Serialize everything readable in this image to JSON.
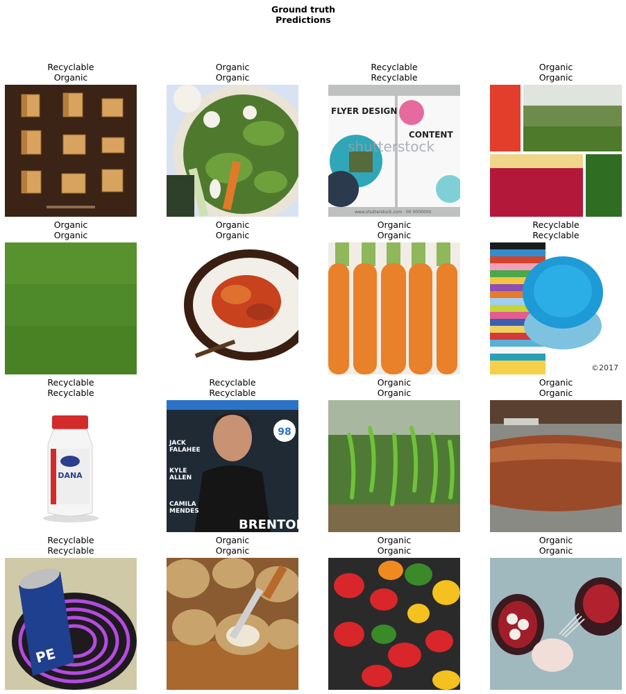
{
  "figure": {
    "title_line1": "Ground truth",
    "title_line2": "Predictions"
  },
  "tiles": [
    {
      "truth": "Recyclable",
      "pred": "Organic",
      "icon": "cardboard-boxes-image"
    },
    {
      "truth": "Organic",
      "pred": "Organic",
      "icon": "vegetable-bowl-image"
    },
    {
      "truth": "Recyclable",
      "pred": "Recyclable",
      "icon": "flyer-design-image",
      "text_a": "FLYER DESIGN",
      "text_b": "CONTENT",
      "text_c": "shutterstock",
      "text_d": "www.shutterstock.com · 00 0000000"
    },
    {
      "truth": "Organic",
      "pred": "Organic",
      "icon": "garden-collage-image"
    },
    {
      "truth": "Organic",
      "pred": "Organic",
      "icon": "grass-image"
    },
    {
      "truth": "Organic",
      "pred": "Organic",
      "icon": "food-plate-image"
    },
    {
      "truth": "Organic",
      "pred": "Organic",
      "icon": "carrots-image"
    },
    {
      "truth": "Recyclable",
      "pred": "Recyclable",
      "icon": "blue-plates-image",
      "text_a": "©2017"
    },
    {
      "truth": "Recyclable",
      "pred": "Recyclable",
      "icon": "milk-bottle-image",
      "text_a": "DANA"
    },
    {
      "truth": "Recyclable",
      "pred": "Recyclable",
      "icon": "magazine-cover-image",
      "text_a": "JACK\nFALAHEE",
      "text_b": "KYLE\nALLEN",
      "text_c": "CAMILA\nMENDES",
      "text_d": "BRENTON",
      "text_e": "98"
    },
    {
      "truth": "Organic",
      "pred": "Organic",
      "icon": "green-chilies-image"
    },
    {
      "truth": "Organic",
      "pred": "Organic",
      "icon": "bread-loaf-image"
    },
    {
      "truth": "Recyclable",
      "pred": "Recyclable",
      "icon": "soda-can-image",
      "text_a": "PE"
    },
    {
      "truth": "Organic",
      "pred": "Organic",
      "icon": "potatoes-image"
    },
    {
      "truth": "Organic",
      "pred": "Organic",
      "icon": "bell-peppers-image"
    },
    {
      "truth": "Organic",
      "pred": "Organic",
      "icon": "mangosteen-image"
    }
  ]
}
